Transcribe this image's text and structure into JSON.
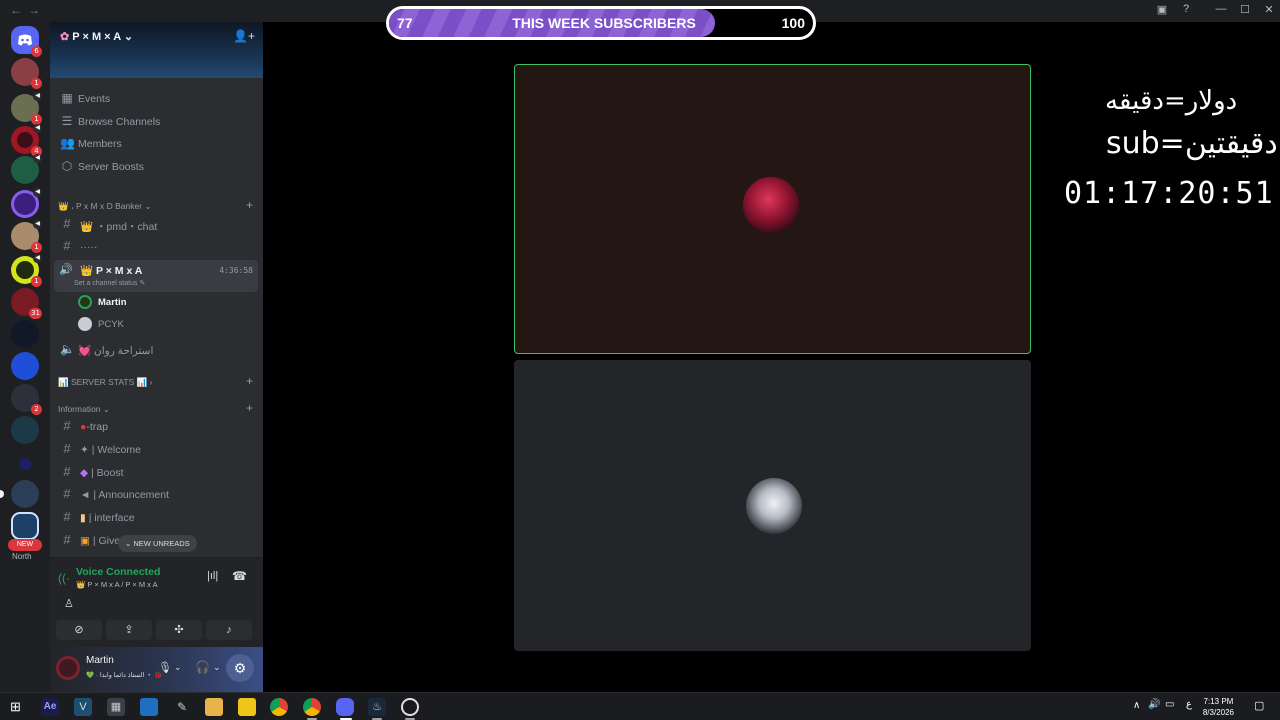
{
  "subscribers": {
    "current": "77",
    "title": "THIS WEEK SUBSCRIBERS",
    "goal": "100",
    "progress_fraction": 0.77
  },
  "overlay": {
    "line1": "دولار=دقيقه",
    "line2": "sub=دقيقتين",
    "timer": "01:17:20:51"
  },
  "server": {
    "name": "P × M × A"
  },
  "menu": [
    {
      "label": "Events",
      "icon": "calendar-icon"
    },
    {
      "label": "Browse Channels",
      "icon": "list-icon"
    },
    {
      "label": "Members",
      "icon": "members-icon"
    },
    {
      "label": "Server Boosts",
      "icon": "boost-icon"
    }
  ],
  "category1": {
    "label": "👑 ، P x M x D Banker"
  },
  "channels_top": [
    {
      "label": "👑 ・pmd・chat"
    },
    {
      "label": "·····"
    }
  ],
  "active_voice": {
    "name": "P × M x A",
    "status": "Set a channel status",
    "time": "4:36:58",
    "members": [
      "Martin",
      "PCYK"
    ]
  },
  "voice2": {
    "label": "💓 استراحة روان"
  },
  "category2": {
    "label": "📊 SERVER STATS 📊"
  },
  "category3": {
    "label": "Information"
  },
  "info_channels": [
    {
      "label": "-trap"
    },
    {
      "label": "Welcome"
    },
    {
      "label": "Boost"
    },
    {
      "label": "Announcement"
    },
    {
      "label": "interface"
    },
    {
      "label": "Give"
    }
  ],
  "new_unreads": "NEW UNREADS",
  "rail_new": "NEW",
  "rail_note": "North",
  "rail_badges": [
    "6",
    "1",
    "1",
    "4",
    "1",
    "1",
    "31",
    "2"
  ],
  "voice_panel": {
    "status": "Voice Connected",
    "channel": "👑 P × M x A / P × M x A"
  },
  "user": {
    "name": "Martin",
    "status": "💚 ·  الستاذ دائما وابدا ・ 🐞"
  },
  "clock": {
    "time": "7:13 PM",
    "date": "8/3/2026"
  },
  "tray": {
    "lang": "ع"
  }
}
